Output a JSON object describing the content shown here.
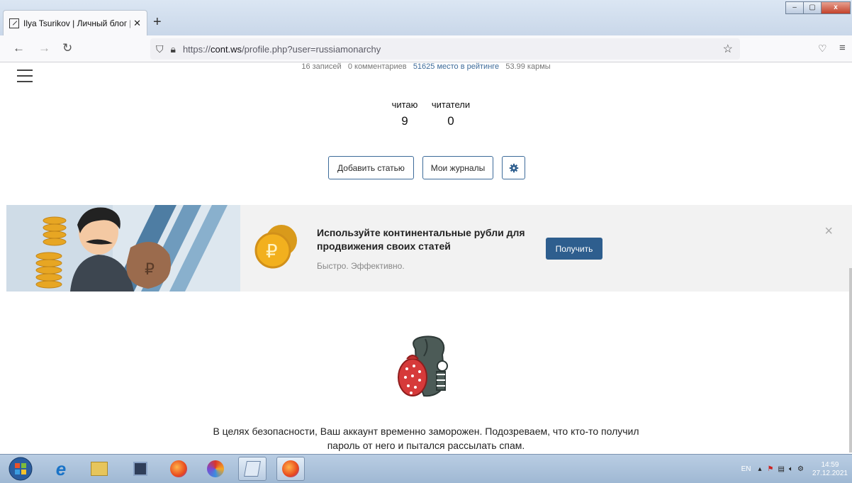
{
  "browser": {
    "tab_title": "Ilya Tsurikov | Личный блог | К",
    "tab_close": "✕",
    "new_tab": "+",
    "url_prefix": "https://",
    "url_domain": "cont.ws",
    "url_path": "/profile.php?user=russiamonarchy"
  },
  "window_controls": {
    "minimize": "–",
    "maximize": "▢",
    "close": "x"
  },
  "profile": {
    "stats": {
      "posts": "16 записей",
      "comments": "0 комментариев",
      "rating": "51625 место в рейтинге",
      "karma": "53.99 кармы"
    },
    "following_label": "читаю",
    "following_count": "9",
    "followers_label": "читатели",
    "followers_count": "0",
    "add_article": "Добавить статью",
    "my_journals": "Мои журналы"
  },
  "promo": {
    "title": "Используйте континентальные рубли для продвижения своих статей",
    "subtitle": "Быстро. Эффективно.",
    "button": "Получить",
    "close": "×"
  },
  "notice": {
    "line1": "В целях безопасности, Ваш аккаунт временно заморожен. Подозреваем, что кто-то получил",
    "line2": "пароль от него и пытался рассылать спам."
  },
  "taskbar": {
    "lang": "EN",
    "time": "14:59",
    "date": "27.12.2021"
  },
  "colors": {
    "accent": "#3d6b9a",
    "promo_button": "#2e5e8e"
  }
}
